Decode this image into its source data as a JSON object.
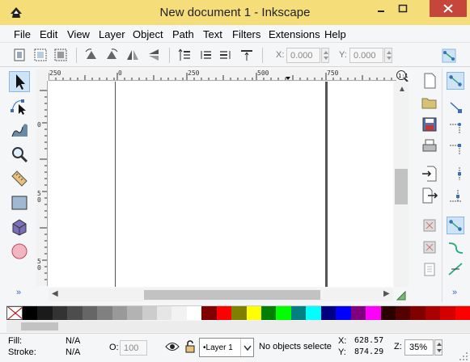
{
  "window": {
    "title": "New document 1 - Inkscape"
  },
  "menu": [
    "File",
    "Edit",
    "View",
    "Layer",
    "Object",
    "Path",
    "Text",
    "Filters",
    "Extensions",
    "Help"
  ],
  "toolbar": {
    "x_label": "X:",
    "x_value": "0.000",
    "y_label": "Y:",
    "y_value": "0.000"
  },
  "ruler": {
    "top_labels": [
      "250",
      "0",
      "250",
      "500",
      "750"
    ],
    "left_labels": [
      "0",
      "5\n0",
      "5\n0",
      "0"
    ]
  },
  "more_label": "»",
  "palette": [
    "#000000",
    "#1a1a1a",
    "#333333",
    "#4d4d4d",
    "#666666",
    "#808080",
    "#999999",
    "#b3b3b3",
    "#cccccc",
    "#e6e6e6",
    "#f2f2f2",
    "#ffffff",
    "#800000",
    "#ff0000",
    "#808000",
    "#ffff00",
    "#008000",
    "#00ff00",
    "#008080",
    "#00ffff",
    "#000080",
    "#0000ff",
    "#800080",
    "#ff00ff",
    "#2b0000",
    "#550000",
    "#800000",
    "#aa0000",
    "#d40000",
    "#ff0000"
  ],
  "status": {
    "fill_label": "Fill:",
    "fill_value": "N/A",
    "stroke_label": "Stroke:",
    "stroke_value": "N/A",
    "opacity_label": "O:",
    "opacity_value": "100",
    "layer_value": "•Layer 1",
    "message": "No objects selecte",
    "x_label": "X:",
    "x_value": "628.57",
    "y_label": "Y:",
    "y_value": "874.29",
    "zoom_label": "Z:",
    "zoom_value": "35%"
  },
  "colors": {
    "titlebar": "#f5dd7a",
    "close": "#c7463c",
    "accent": "#3a6fb0"
  }
}
